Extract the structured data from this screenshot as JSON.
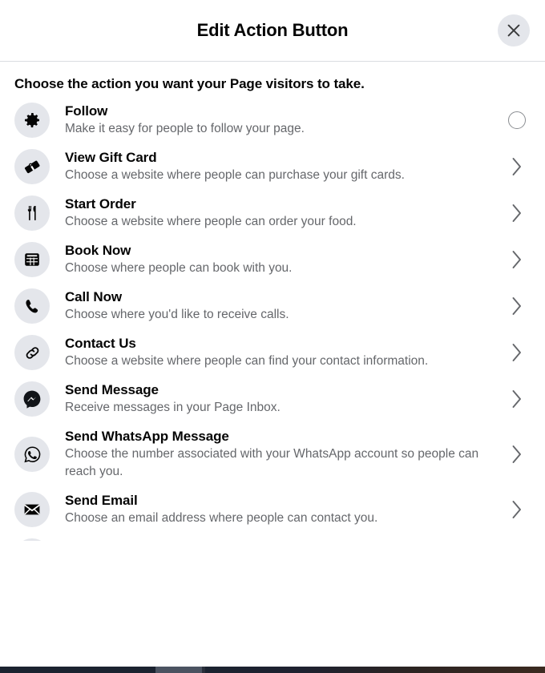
{
  "header": {
    "title": "Edit Action Button",
    "close_icon": "close-icon",
    "close_label": "Close"
  },
  "body": {
    "subtitle": "Choose the action you want your Page visitors to take."
  },
  "options": [
    {
      "id": "follow",
      "icon": "gear-icon",
      "title": "Follow",
      "description": "Make it easy for people to follow your page.",
      "trailing": "radio",
      "selected": false
    },
    {
      "id": "view-gift-card",
      "icon": "gift-card-icon",
      "title": "View Gift Card",
      "description": "Choose a website where people can purchase your gift cards.",
      "trailing": "chevron"
    },
    {
      "id": "start-order",
      "icon": "fork-knife-icon",
      "title": "Start Order",
      "description": "Choose a website where people can order your food.",
      "trailing": "chevron"
    },
    {
      "id": "book-now",
      "icon": "calendar-icon",
      "title": "Book Now",
      "description": "Choose where people can book with you.",
      "trailing": "chevron"
    },
    {
      "id": "call-now",
      "icon": "phone-icon",
      "title": "Call Now",
      "description": "Choose where you'd like to receive calls.",
      "trailing": "chevron"
    },
    {
      "id": "contact-us",
      "icon": "link-icon",
      "title": "Contact Us",
      "description": "Choose a website where people can find your contact information.",
      "trailing": "chevron"
    },
    {
      "id": "send-message",
      "icon": "messenger-icon",
      "title": "Send Message",
      "description": "Receive messages in your Page Inbox.",
      "trailing": "chevron"
    },
    {
      "id": "send-whatsapp-message",
      "icon": "whatsapp-icon",
      "title": "Send WhatsApp Message",
      "description": "Choose the number associated with your WhatsApp account so people can reach you.",
      "trailing": "chevron"
    },
    {
      "id": "send-email",
      "icon": "envelope-icon",
      "title": "Send Email",
      "description": "Choose an email address where people can contact you.",
      "trailing": "chevron"
    }
  ],
  "colors": {
    "icon_badge_bg": "#e4e6eb",
    "text_primary": "#050505",
    "text_secondary": "#65676b",
    "divider": "#dadde1",
    "surface": "#ffffff"
  }
}
